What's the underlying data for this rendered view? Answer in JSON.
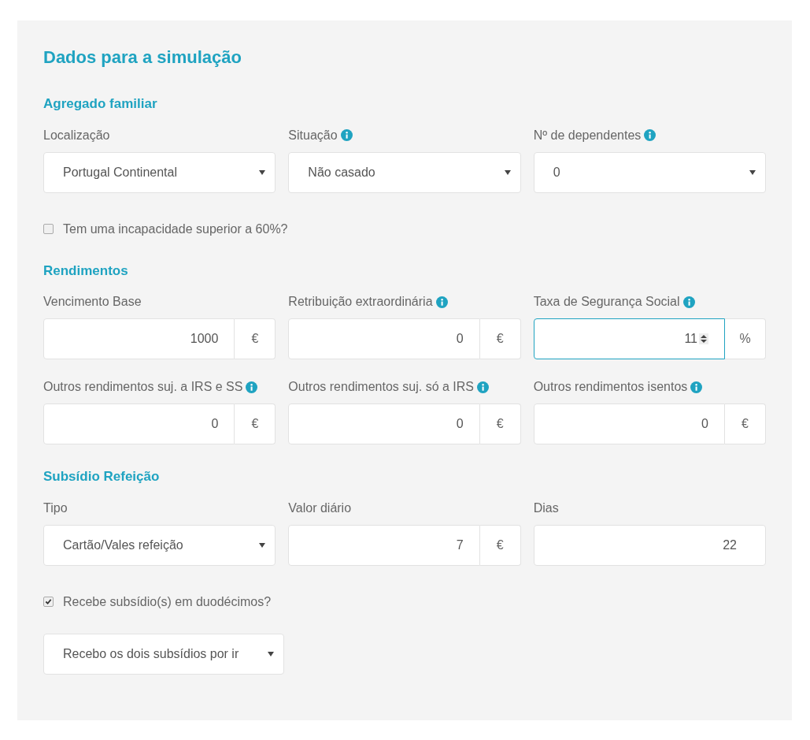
{
  "title": "Dados para a simulação",
  "sections": [
    {
      "heading": "Agregado familiar",
      "fields": [
        {
          "kind": "select",
          "label": "Localização",
          "info": false,
          "value": "Portugal Continental"
        },
        {
          "kind": "select",
          "label": "Situação",
          "info": true,
          "value": "Não casado"
        },
        {
          "kind": "select",
          "label": "Nº de dependentes",
          "info": true,
          "value": "0"
        }
      ],
      "checkbox": {
        "label": "Tem uma incapacidade superior a 60%?",
        "checked": false
      }
    },
    {
      "heading": "Rendimentos",
      "fields": [
        {
          "kind": "unit",
          "label": "Vencimento Base",
          "info": false,
          "value": "1000",
          "unit": "€",
          "focused": false
        },
        {
          "kind": "unit",
          "label": "Retribuição extraordinária",
          "info": true,
          "value": "0",
          "unit": "€",
          "focused": false
        },
        {
          "kind": "unit",
          "label": "Taxa de Segurança Social",
          "info": true,
          "value": "11",
          "unit": "%",
          "focused": true
        },
        {
          "kind": "unit",
          "label": "Outros rendimentos suj. a IRS e SS",
          "info": true,
          "value": "0",
          "unit": "€",
          "focused": false
        },
        {
          "kind": "unit",
          "label": "Outros rendimentos suj. só a IRS",
          "info": true,
          "value": "0",
          "unit": "€",
          "focused": false
        },
        {
          "kind": "unit",
          "label": "Outros rendimentos isentos",
          "info": true,
          "value": "0",
          "unit": "€",
          "focused": false
        }
      ]
    },
    {
      "heading": "Subsídio Refeição",
      "fields": [
        {
          "kind": "select",
          "label": "Tipo",
          "info": false,
          "value": "Cartão/Vales refeição"
        },
        {
          "kind": "unit",
          "label": "Valor diário",
          "info": false,
          "value": "7",
          "unit": "€",
          "focused": false
        },
        {
          "kind": "plain",
          "label": "Dias",
          "info": false,
          "value": "22"
        }
      ],
      "checkbox": {
        "label": "Recebe subsídio(s) em duodécimos?",
        "checked": true
      },
      "extra_select": {
        "value": "Recebo os dois subsídios por ir"
      }
    }
  ]
}
